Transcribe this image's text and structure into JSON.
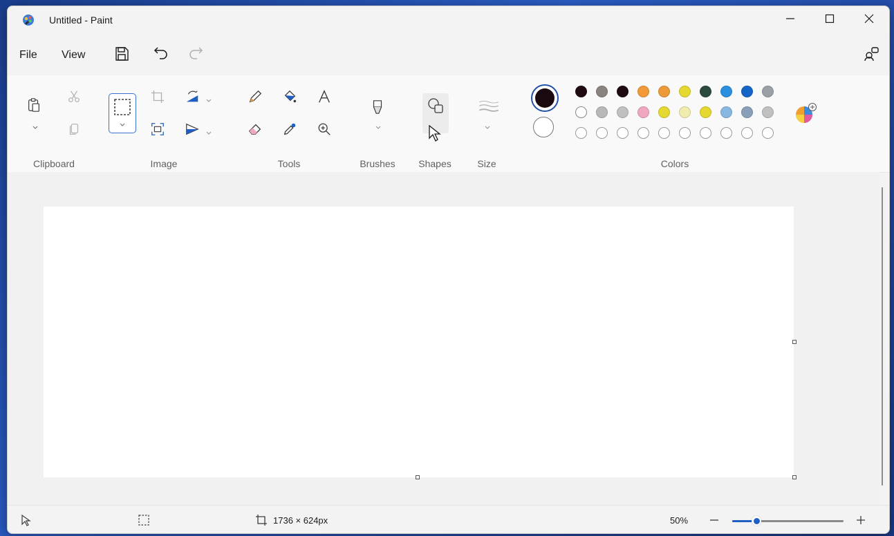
{
  "window": {
    "title": "Untitled - Paint"
  },
  "menu": {
    "file": "File",
    "view": "View"
  },
  "ribbon": {
    "groups": {
      "clipboard": "Clipboard",
      "image": "Image",
      "tools": "Tools",
      "brushes": "Brushes",
      "shapes": "Shapes",
      "size": "Size",
      "colors": "Colors"
    },
    "colors": {
      "primary": "#1a0a10",
      "secondary": "#ffffff",
      "palette_row1": [
        "#1f0a12",
        "#8a8480",
        "#1f0a12",
        "#f09a3a",
        "#ec9a3a",
        "#e5d830",
        "#2d4a3e",
        "#2b8fe0",
        "#1565c8",
        "#9aa0a6"
      ],
      "palette_row2": [
        "#ffffff",
        "#b8b8b8",
        "#c0c0c0",
        "#f0a8c0",
        "#e5d830",
        "#f0ecb0",
        "#e5d830",
        "#88b8e0",
        "#8aa0b8",
        "#c0c0c0"
      ],
      "palette_row3": [
        "#ffffff",
        "#ffffff",
        "#ffffff",
        "#ffffff",
        "#ffffff",
        "#ffffff",
        "#ffffff",
        "#ffffff",
        "#ffffff",
        "#ffffff"
      ]
    }
  },
  "status": {
    "canvas_size": "1736 × 624px",
    "zoom_label": "50%",
    "zoom_level": 0.22
  }
}
